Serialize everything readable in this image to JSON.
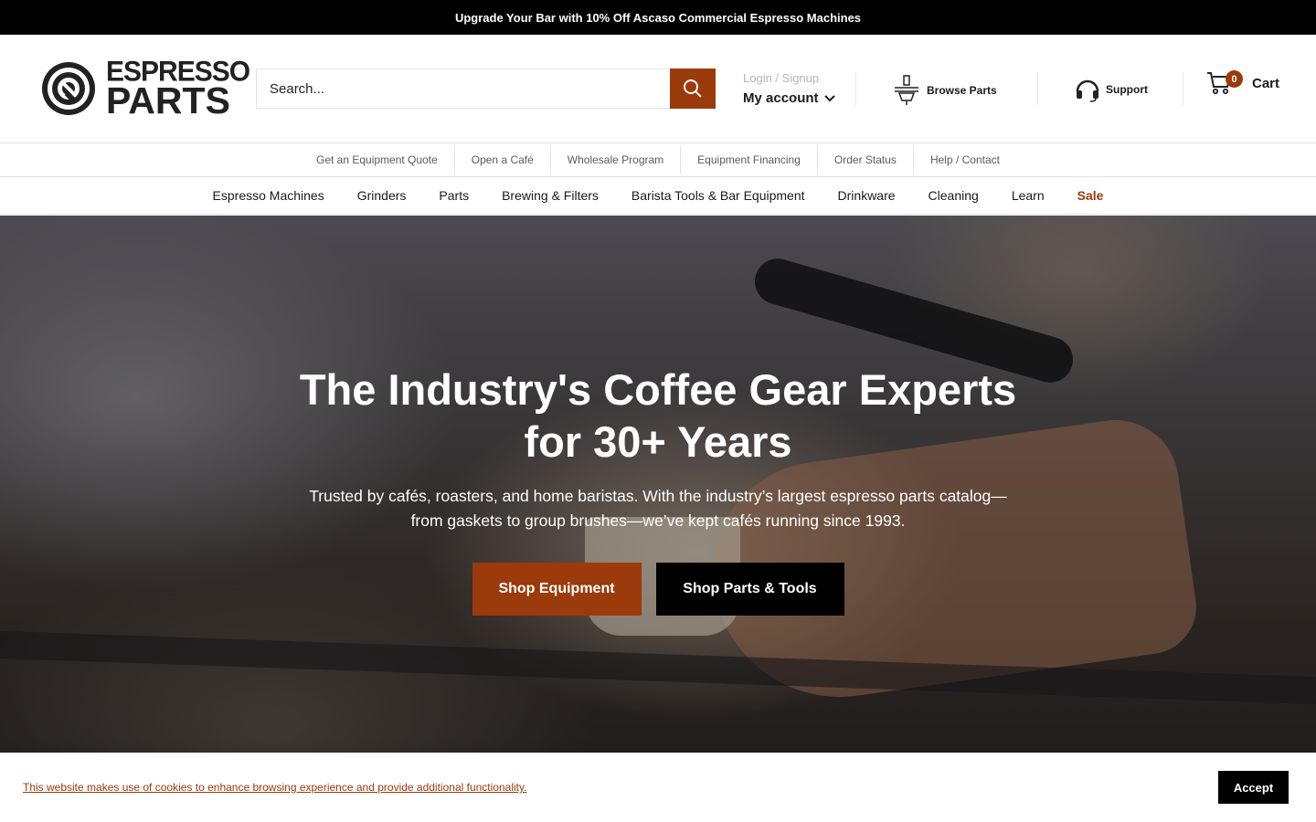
{
  "announcement": "Upgrade Your Bar with 10% Off Ascaso Commercial Espresso Machines",
  "logo": {
    "line1": "ESPRESSO",
    "line2": "PARTS"
  },
  "search": {
    "placeholder": "Search..."
  },
  "account": {
    "small": "Login / Signup",
    "label": "My account"
  },
  "header_links": {
    "browse": "Browse Parts",
    "support": "Support"
  },
  "cart": {
    "count": "0",
    "label": "Cart"
  },
  "utility_nav": [
    "Get an Equipment Quote",
    "Open a Café",
    "Wholesale Program",
    "Equipment Financing",
    "Order Status",
    "Help / Contact"
  ],
  "main_nav": [
    "Espresso Machines",
    "Grinders",
    "Parts",
    "Brewing & Filters",
    "Barista Tools & Bar Equipment",
    "Drinkware",
    "Cleaning",
    "Learn",
    "Sale"
  ],
  "hero": {
    "title_line1": "The Industry's Coffee Gear Experts",
    "title_line2": "for 30+ Years",
    "subtitle_line1": "Trusted by cafés, roasters, and home baristas. With the industry’s largest espresso parts catalog—",
    "subtitle_line2": "from gaskets to group brushes—we’ve kept cafés running since 1993.",
    "primary_button": "Shop Equipment",
    "secondary_button": "Shop Parts & Tools"
  },
  "cookie": {
    "text": "This website makes use of cookies to enhance browsing experience and provide additional functionality.",
    "accept": "Accept"
  },
  "colors": {
    "accent": "#9b3a0b",
    "announcement_bg": "#000000"
  },
  "icons": {
    "logo_mark": "espresso-parts-logo-icon",
    "search": "search-icon",
    "chevron": "chevron-down-icon",
    "browse": "portafilter-icon",
    "support": "headset-icon",
    "cart": "cart-icon"
  }
}
